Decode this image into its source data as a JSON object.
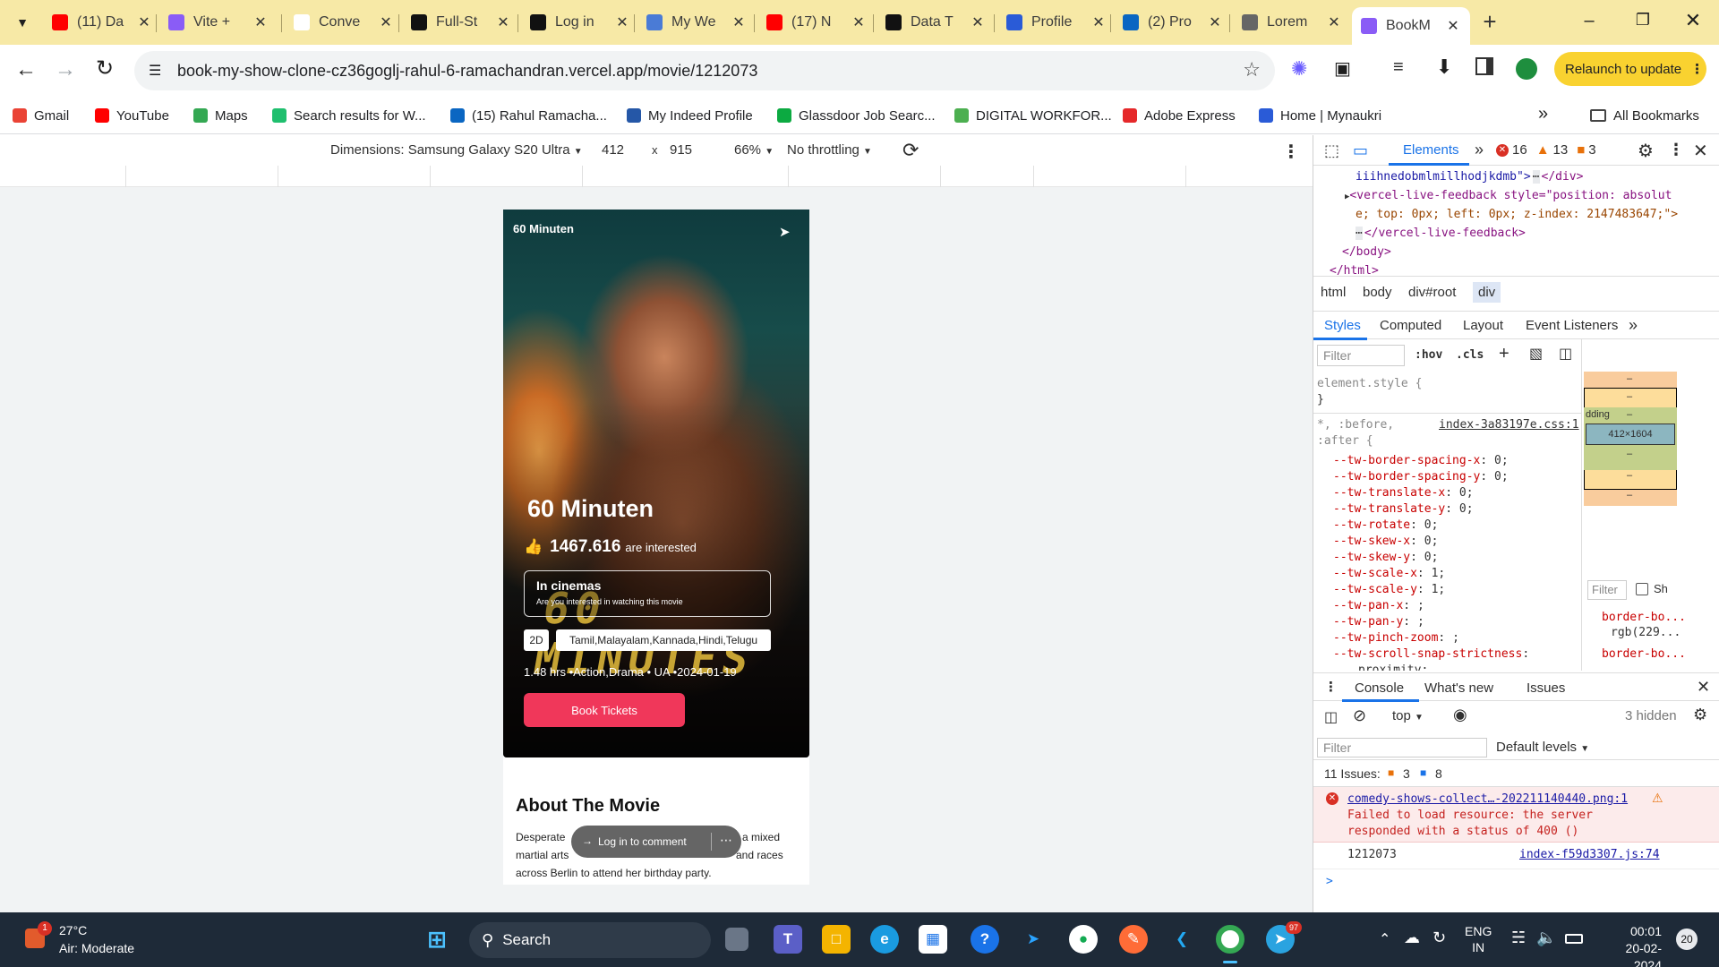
{
  "tabs": [
    {
      "title": "(11) Da",
      "fav": "youtube-icon",
      "color": "#ff0000"
    },
    {
      "title": "Vite +",
      "fav": "vite-icon",
      "color": "#8a5cf6"
    },
    {
      "title": "Conve",
      "fav": "w-icon",
      "color": "#ffffff"
    },
    {
      "title": "Full-St",
      "fav": "fullstack-icon",
      "color": "#111111"
    },
    {
      "title": "Log in",
      "fav": "mongodb-icon",
      "color": "#111111"
    },
    {
      "title": "My We",
      "fav": "r-icon",
      "color": "#4a7bd6"
    },
    {
      "title": "(17) N",
      "fav": "youtube-icon",
      "color": "#ff0000"
    },
    {
      "title": "Data T",
      "fav": "notion-icon",
      "color": "#111111"
    },
    {
      "title": "Profile",
      "fav": "naukri-icon",
      "color": "#2a5bd7"
    },
    {
      "title": "(2) Pro",
      "fav": "linkedin-icon",
      "color": "#0a66c2"
    },
    {
      "title": "Lorem",
      "fav": "globe-icon",
      "color": "#666666"
    },
    {
      "title": "BookM",
      "fav": "vercel-icon",
      "color": "#8a5cf6"
    }
  ],
  "address": {
    "url": "book-my-show-clone-cz36goglj-rahul-6-ramachandran.vercel.app/movie/1212073",
    "relaunch": "Relaunch to update"
  },
  "bookmarks": [
    {
      "label": "Gmail",
      "color": "#ea4335"
    },
    {
      "label": "YouTube",
      "color": "#ff0000"
    },
    {
      "label": "Maps",
      "color": "#34a853"
    },
    {
      "label": "Search results for W...",
      "color": "#1fbf6e"
    },
    {
      "label": "(15) Rahul Ramacha...",
      "color": "#0a66c2"
    },
    {
      "label": "My Indeed Profile",
      "color": "#2557a7"
    },
    {
      "label": "Glassdoor Job Searc...",
      "color": "#0caa41"
    },
    {
      "label": "DIGITAL WORKFOR...",
      "color": "#4caf50"
    },
    {
      "label": "Adobe Express",
      "color": "#e5282a"
    },
    {
      "label": "Home | Mynaukri",
      "color": "#2a5bd7"
    }
  ],
  "all_bookmarks": "All Bookmarks",
  "device_toolbar": {
    "dimensions": "Dimensions: Samsung Galaxy S20 Ultra",
    "width": "412",
    "height": "915",
    "times": "x",
    "zoom": "66%",
    "throttling": "No throttling"
  },
  "movie": {
    "header_title": "60 Minuten",
    "title": "60 Minuten",
    "interested_count": "1467.616",
    "interested_text": "are interested",
    "neon_text": "60 MINUTES",
    "in_cinemas": "In cinemas",
    "in_cinemas_sub": "Are you interested in watching this movie",
    "format": "2D",
    "languages": "Tamil,Malayalam,Kannada,Hindi,Telugu",
    "meta": "1.48 hrs •Action,Drama • UA •2024-01-19",
    "book_button": "Book Tickets",
    "about_title": "About The Movie",
    "about_line1_start": "Desperate",
    "about_line1_end": "a mixed",
    "about_line2_start": "martial arts",
    "about_line2_end": "and races",
    "about_line3": "across Berlin to attend her birthday party.",
    "login_comment": "Log in to comment"
  },
  "devtools": {
    "tabs": {
      "elements": "Elements",
      "errors": "16",
      "warnings": "13",
      "issues": "3"
    },
    "html_lines": [
      {
        "text": "iiihnedobmlmillhodjkdmb\">",
        "suffix": "</div>"
      },
      {
        "text": "<vercel-live-feedback style=\"position: absolut"
      },
      {
        "text": "e; top: 0px; left: 0px; z-index: 2147483647;\">"
      },
      {
        "text": "</vercel-live-feedback>"
      },
      {
        "text": "</body>"
      },
      {
        "text": "</html>"
      }
    ],
    "breadcrumb": [
      "html",
      "body",
      "div#root",
      "div"
    ],
    "subtabs": [
      "Styles",
      "Computed",
      "Layout",
      "Event Listeners"
    ],
    "filter_placeholder": "Filter",
    "hov": ":hov",
    "cls": ".cls",
    "element_style": "element.style {",
    "close_brace": "}",
    "selector": "*, :before,",
    "selector2": ":after {",
    "source": "index-3a83197e.css:1",
    "css_props": [
      [
        "--tw-border-spacing-x",
        "0;"
      ],
      [
        "--tw-border-spacing-y",
        "0;"
      ],
      [
        "--tw-translate-x",
        "0;"
      ],
      [
        "--tw-translate-y",
        "0;"
      ],
      [
        "--tw-rotate",
        "0;"
      ],
      [
        "--tw-skew-x",
        "0;"
      ],
      [
        "--tw-skew-y",
        "0;"
      ],
      [
        "--tw-scale-x",
        "1;"
      ],
      [
        "--tw-scale-y",
        "1;"
      ],
      [
        "--tw-pan-x",
        " ;"
      ],
      [
        "--tw-pan-y",
        " ;"
      ],
      [
        "--tw-pinch-zoom",
        " ;"
      ],
      [
        "--tw-scroll-snap-strictness",
        ""
      ]
    ],
    "css_last": "proximity;",
    "box_size": "412×1604",
    "box_padding": "dding",
    "box_dash": "–",
    "computed_filter": "Filter",
    "show_all": "Sh",
    "computed_props": [
      "border-bo...",
      "rgb(229...",
      "border-bo..."
    ],
    "console_tabs": [
      "Console",
      "What's new",
      "Issues"
    ],
    "console_context": "top",
    "hidden": "3 hidden",
    "default_levels": "Default levels",
    "issues_label": "11 Issues:",
    "issues_a": "3",
    "issues_b": "8",
    "error_link": "comedy-shows-collect…-202211140440.png:1",
    "error_msg1": "Failed to load resource: the server",
    "error_msg2": "responded with a status of 400 ()",
    "log_value": "1212073",
    "log_source": "index-f59d3307.js:74",
    "prompt": ">"
  },
  "taskbar": {
    "weather_temp": "27°C",
    "weather_desc": "Air: Moderate",
    "weather_badge": "1",
    "search": "Search",
    "lang1": "ENG",
    "lang2": "IN",
    "time": "00:01",
    "date": "20-02-2024",
    "notif": "20",
    "telegram_badge": "97"
  }
}
